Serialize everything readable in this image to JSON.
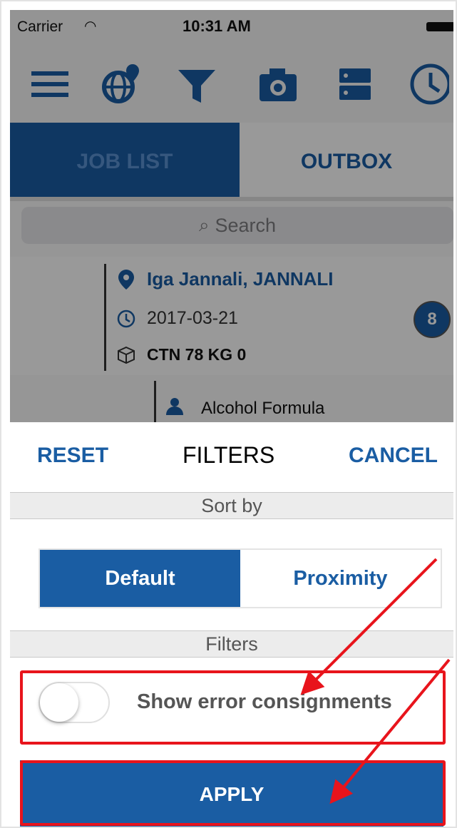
{
  "status_bar": {
    "carrier": "Carrier",
    "time": "10:31 AM"
  },
  "toolbar": {
    "icons": [
      "menu-icon",
      "globe-location-icon",
      "filter-icon",
      "camera-icon",
      "server-icon",
      "clock-icon"
    ]
  },
  "tabs": {
    "job_list": "JOB LIST",
    "outbox": "OUTBOX"
  },
  "search": {
    "placeholder": "Search"
  },
  "job": {
    "address": "Iga Jannali, JANNALI",
    "date": "2017-03-21",
    "package": "CTN 78 KG 0",
    "badge_count": "8"
  },
  "job2": {
    "person": "Alcohol Formula"
  },
  "filter_sheet": {
    "reset_label": "RESET",
    "title": "FILTERS",
    "cancel_label": "CANCEL",
    "sort_by_header": "Sort by",
    "sort_options": [
      "Default",
      "Proximity"
    ],
    "selected_sort": "Default",
    "filters_header": "Filters",
    "toggle_label": "Show error consignments",
    "toggle_on": false,
    "apply_label": "APPLY"
  },
  "colors": {
    "accent": "#1a5da3",
    "annotation": "#e8141c"
  }
}
